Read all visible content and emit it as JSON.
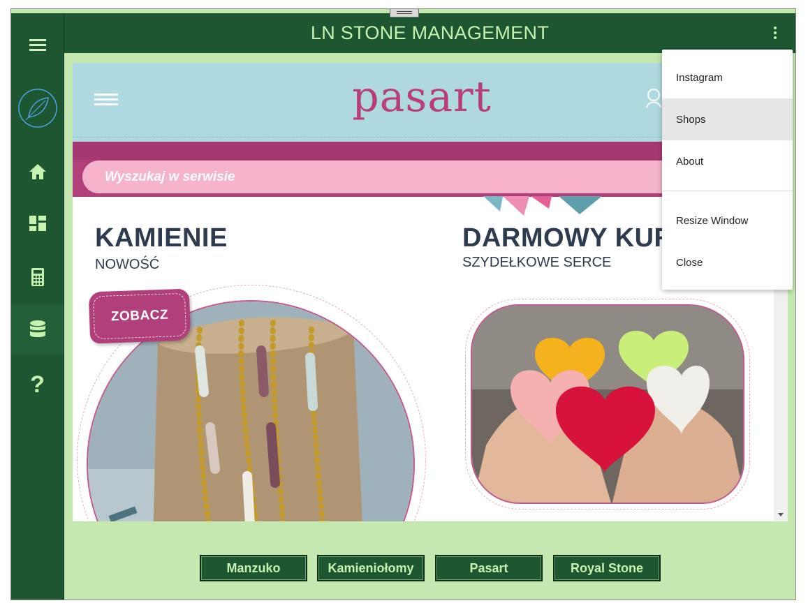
{
  "app": {
    "title": "LN STONE MANAGEMENT"
  },
  "colors": {
    "sidebar": "#1e5631",
    "background": "#c5e8b0",
    "accent_text": "#c7f2b0",
    "brand_pink": "#b03f7c"
  },
  "sidebar": {
    "items": [
      {
        "name": "menu",
        "icon": "hamburger-icon"
      },
      {
        "name": "logo",
        "icon": "leaf-icon"
      },
      {
        "name": "home",
        "icon": "home-icon"
      },
      {
        "name": "dashboard",
        "icon": "dashboard-icon"
      },
      {
        "name": "calculator",
        "icon": "calculator-icon"
      },
      {
        "name": "database",
        "icon": "database-icon",
        "active": true
      },
      {
        "name": "help",
        "icon": "help-icon",
        "label": "?"
      }
    ]
  },
  "menu": {
    "items": [
      {
        "label": "Instagram"
      },
      {
        "label": "Shops",
        "highlighted": true
      },
      {
        "label": "About"
      },
      {
        "label": "Resize Window"
      },
      {
        "label": "Close"
      }
    ]
  },
  "website": {
    "logo": "pasart",
    "search_placeholder": "Wyszukaj w serwisie",
    "promo_left": {
      "title": "KAMIENIE",
      "subtitle": "NOWOŚĆ",
      "button": "ZOBACZ"
    },
    "promo_right": {
      "title": "DARMOWY KUR",
      "subtitle": "SZYDEŁKOWE SERCE"
    }
  },
  "shops": {
    "buttons": [
      "Manzuko",
      "Kamieniołomy",
      "Pasart",
      "Royal Stone"
    ]
  }
}
